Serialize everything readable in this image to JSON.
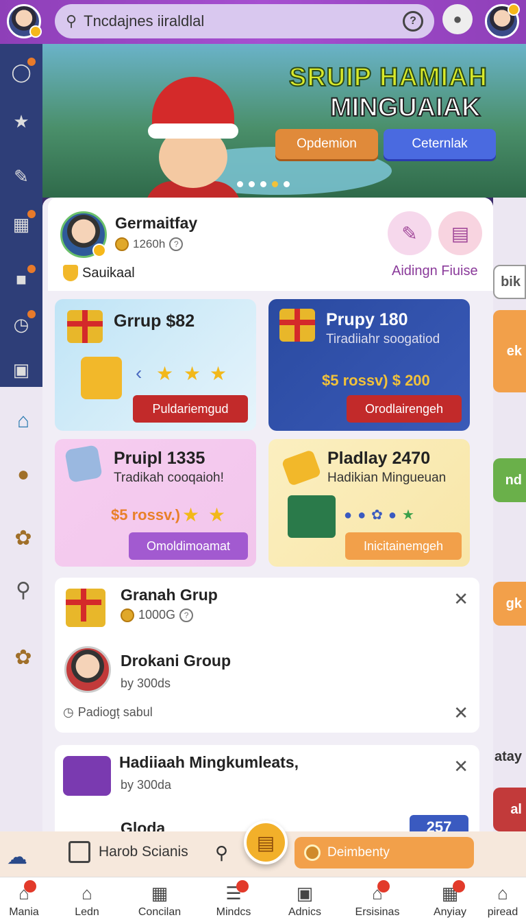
{
  "search": {
    "placeholder": "Tncdajnes iiraldlal"
  },
  "banner": {
    "title_line1": "SRUIP HAMIAH",
    "title_line2": "MINGUAIAK",
    "button1": "Opdemion",
    "button2": "Ceternlak"
  },
  "profile": {
    "name": "Germaitfay",
    "points": "1260h",
    "rank": "Sauikaal",
    "link": "Aidingn Fiuise"
  },
  "cards": [
    {
      "title": "Grrup $82",
      "button": "Puldariemgud"
    },
    {
      "title": "Prupy 180",
      "subtitle": "Tiradiiahr soogatiod",
      "price": "$5 rossv) $ 200",
      "button": "Orodlairengeh"
    },
    {
      "title": "Pruipl 1335",
      "subtitle": "Tradikah cooqaioh!",
      "price": "$5 rossv.)",
      "button": "Omoldimoamat"
    },
    {
      "title": "Pladlay 2470",
      "subtitle": "Hadikian Mingueuan",
      "button": "Inicitainemgeh"
    }
  ],
  "group_card": {
    "title": "Granah Grup",
    "points": "1000G",
    "item_title": "Drokani Group",
    "item_sub": "by 300ds",
    "footer": "Padiogț sabul"
  },
  "list_card2": {
    "title": "Hadiiaah Mingkumleats,",
    "sub": "by 300da",
    "next_title": "Gloda",
    "badge": "257"
  },
  "action_bar": {
    "label": "Harob Scianis",
    "button": "Deimbenty"
  },
  "right_strip": [
    "bik",
    "ek",
    "nd",
    "gk",
    "atay",
    "al"
  ],
  "nav": [
    {
      "label": "Mania"
    },
    {
      "label": "Ledn"
    },
    {
      "label": "Concilan"
    },
    {
      "label": "Mindcs"
    },
    {
      "label": "Adnics"
    },
    {
      "label": "Ersisinas"
    },
    {
      "label": "Anyiay"
    },
    {
      "label": "piread"
    }
  ]
}
